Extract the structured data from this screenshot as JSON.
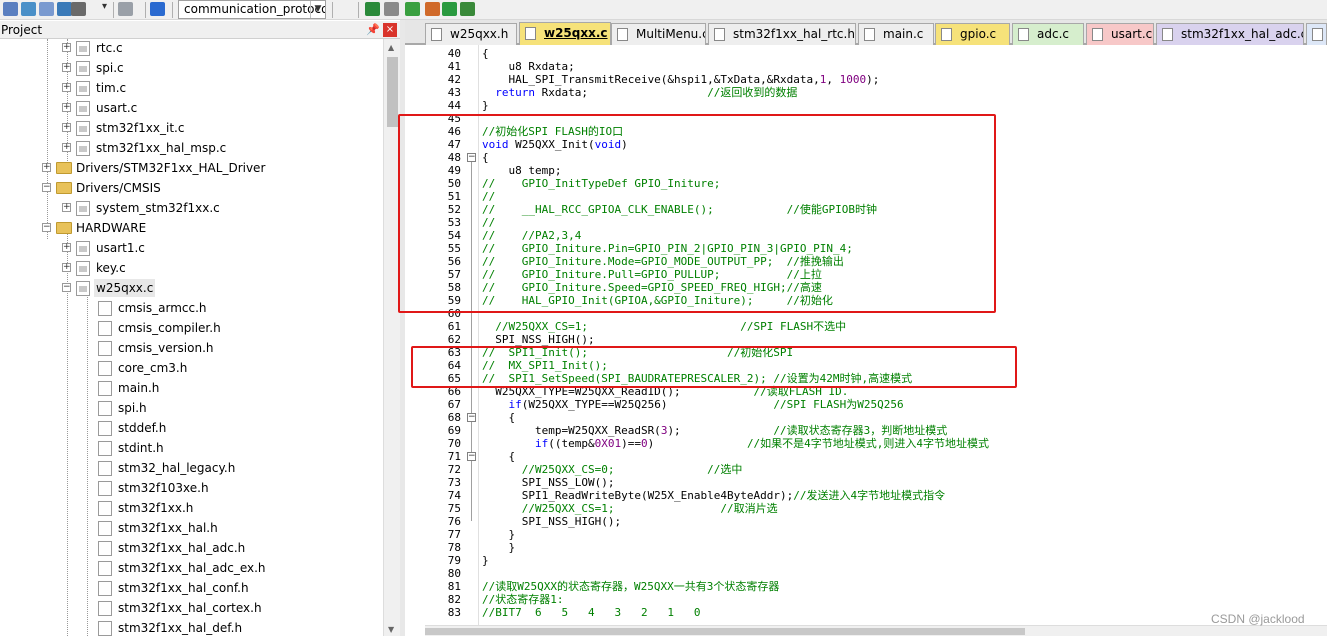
{
  "toolbar": {
    "target_combo": "communication_protoco",
    "icons": [
      "load-icon",
      "download-icon",
      "rebuild-icon",
      "translate-icon",
      "batch-build-icon",
      "options-icon",
      "debug-icon",
      "manage-components-icon",
      "pack-installer-icon",
      "select-packs-icon",
      "rte-icon",
      "run-icon",
      "template-icon"
    ]
  },
  "project_panel": {
    "title": "Project",
    "pin": "q",
    "close": "×"
  },
  "tree": [
    {
      "label": "rtc.c",
      "depth": 3,
      "type": "src",
      "expander": "+"
    },
    {
      "label": "spi.c",
      "depth": 3,
      "type": "src",
      "expander": "+"
    },
    {
      "label": "tim.c",
      "depth": 3,
      "type": "src",
      "expander": "+"
    },
    {
      "label": "usart.c",
      "depth": 3,
      "type": "src",
      "expander": "+"
    },
    {
      "label": "stm32f1xx_it.c",
      "depth": 3,
      "type": "src",
      "expander": "+"
    },
    {
      "label": "stm32f1xx_hal_msp.c",
      "depth": 3,
      "type": "src",
      "expander": "+"
    },
    {
      "label": "Drivers/STM32F1xx_HAL_Driver",
      "depth": 2,
      "type": "folder",
      "expander": "+"
    },
    {
      "label": "Drivers/CMSIS",
      "depth": 2,
      "type": "folder",
      "expander": "−"
    },
    {
      "label": "system_stm32f1xx.c",
      "depth": 3,
      "type": "src",
      "expander": "+"
    },
    {
      "label": "HARDWARE",
      "depth": 2,
      "type": "folder",
      "expander": "−"
    },
    {
      "label": "usart1.c",
      "depth": 3,
      "type": "src",
      "expander": "+"
    },
    {
      "label": "key.c",
      "depth": 3,
      "type": "src",
      "expander": "+"
    },
    {
      "label": "w25qxx.c",
      "depth": 3,
      "type": "src",
      "expander": "−",
      "selected": true
    },
    {
      "label": "cmsis_armcc.h",
      "depth": 4,
      "type": "hdr"
    },
    {
      "label": "cmsis_compiler.h",
      "depth": 4,
      "type": "hdr"
    },
    {
      "label": "cmsis_version.h",
      "depth": 4,
      "type": "hdr"
    },
    {
      "label": "core_cm3.h",
      "depth": 4,
      "type": "hdr"
    },
    {
      "label": "main.h",
      "depth": 4,
      "type": "hdr"
    },
    {
      "label": "spi.h",
      "depth": 4,
      "type": "hdr"
    },
    {
      "label": "stddef.h",
      "depth": 4,
      "type": "hdr"
    },
    {
      "label": "stdint.h",
      "depth": 4,
      "type": "hdr"
    },
    {
      "label": "stm32_hal_legacy.h",
      "depth": 4,
      "type": "hdr"
    },
    {
      "label": "stm32f103xe.h",
      "depth": 4,
      "type": "hdr"
    },
    {
      "label": "stm32f1xx.h",
      "depth": 4,
      "type": "hdr"
    },
    {
      "label": "stm32f1xx_hal.h",
      "depth": 4,
      "type": "hdr"
    },
    {
      "label": "stm32f1xx_hal_adc.h",
      "depth": 4,
      "type": "hdr"
    },
    {
      "label": "stm32f1xx_hal_adc_ex.h",
      "depth": 4,
      "type": "hdr"
    },
    {
      "label": "stm32f1xx_hal_conf.h",
      "depth": 4,
      "type": "hdr"
    },
    {
      "label": "stm32f1xx_hal_cortex.h",
      "depth": 4,
      "type": "hdr"
    },
    {
      "label": "stm32f1xx_hal_def.h",
      "depth": 4,
      "type": "hdr"
    }
  ],
  "tabs": [
    {
      "label": "w25qxx.h",
      "color": "#eeeeee",
      "active": false
    },
    {
      "label": "w25qxx.c",
      "color": "#f6e27a",
      "active": true
    },
    {
      "label": "MultiMenu.c",
      "color": "#eeeeee",
      "active": false
    },
    {
      "label": "stm32f1xx_hal_rtc.h",
      "color": "#eeeeee",
      "active": false
    },
    {
      "label": "main.c",
      "color": "#eeeeee",
      "active": false
    },
    {
      "label": "gpio.c",
      "color": "#f6e27a",
      "active": false
    },
    {
      "label": "adc.c",
      "color": "#d6eecd",
      "active": false
    },
    {
      "label": "usart.c",
      "color": "#f7c8c8",
      "active": false
    },
    {
      "label": "stm32f1xx_hal_adc.c",
      "color": "#d9d2ee",
      "active": false
    },
    {
      "label": "",
      "color": "#dde7f7",
      "active": false
    }
  ],
  "code": [
    {
      "n": "40",
      "fold": "",
      "t": [
        [
          "",
          "{"
        ]
      ]
    },
    {
      "n": "41",
      "fold": "",
      "t": [
        [
          "",
          "    u8 Rxdata;"
        ]
      ]
    },
    {
      "n": "42",
      "fold": "",
      "t": [
        [
          "",
          "    HAL_SPI_TransmitReceive(&hspi1,&TxData,&Rxdata,"
        ],
        [
          "num",
          "1"
        ],
        [
          "",
          ", "
        ],
        [
          "num",
          "1000"
        ],
        [
          "",
          ");"
        ]
      ]
    },
    {
      "n": "43",
      "fold": "",
      "t": [
        [
          "",
          "  "
        ],
        [
          "kw",
          "return"
        ],
        [
          "",
          " Rxdata;                  "
        ],
        [
          "cm",
          "//返回收到的数据"
        ]
      ]
    },
    {
      "n": "44",
      "fold": "",
      "t": [
        [
          "",
          "}"
        ]
      ]
    },
    {
      "n": "45",
      "fold": "",
      "t": [
        [
          "",
          ""
        ]
      ]
    },
    {
      "n": "46",
      "fold": "",
      "t": [
        [
          "cm",
          "//初始化SPI FLASH的IO口"
        ]
      ]
    },
    {
      "n": "47",
      "fold": "",
      "t": [
        [
          "kw",
          "void"
        ],
        [
          "",
          " W25QXX_Init("
        ],
        [
          "kw",
          "void"
        ],
        [
          "",
          ")"
        ]
      ]
    },
    {
      "n": "48",
      "fold": "−",
      "t": [
        [
          "",
          "{"
        ]
      ]
    },
    {
      "n": "49",
      "fold": "",
      "t": [
        [
          "",
          "    u8 temp;"
        ]
      ]
    },
    {
      "n": "50",
      "fold": "",
      "t": [
        [
          "cm",
          "//    GPIO_InitTypeDef GPIO_Initure;"
        ]
      ]
    },
    {
      "n": "51",
      "fold": "",
      "t": [
        [
          "cm",
          "//"
        ]
      ]
    },
    {
      "n": "52",
      "fold": "",
      "t": [
        [
          "cm",
          "//    __HAL_RCC_GPIOA_CLK_ENABLE();           //使能GPIOB时钟"
        ]
      ]
    },
    {
      "n": "53",
      "fold": "",
      "t": [
        [
          "cm",
          "//"
        ]
      ]
    },
    {
      "n": "54",
      "fold": "",
      "t": [
        [
          "cm",
          "//    //PA2,3,4"
        ]
      ]
    },
    {
      "n": "55",
      "fold": "",
      "t": [
        [
          "cm",
          "//    GPIO_Initure.Pin=GPIO_PIN_2|GPIO_PIN_3|GPIO_PIN_4;"
        ]
      ]
    },
    {
      "n": "56",
      "fold": "",
      "t": [
        [
          "cm",
          "//    GPIO_Initure.Mode=GPIO_MODE_OUTPUT_PP;  //推挽输出"
        ]
      ]
    },
    {
      "n": "57",
      "fold": "",
      "t": [
        [
          "cm",
          "//    GPIO_Initure.Pull=GPIO_PULLUP;          //上拉"
        ]
      ]
    },
    {
      "n": "58",
      "fold": "",
      "t": [
        [
          "cm",
          "//    GPIO_Initure.Speed=GPIO_SPEED_FREQ_HIGH;//高速"
        ]
      ]
    },
    {
      "n": "59",
      "fold": "",
      "t": [
        [
          "cm",
          "//    HAL_GPIO_Init(GPIOA,&GPIO_Initure);     //初始化"
        ]
      ]
    },
    {
      "n": "60",
      "fold": "",
      "t": [
        [
          "",
          ""
        ]
      ]
    },
    {
      "n": "61",
      "fold": "",
      "t": [
        [
          "",
          "  "
        ],
        [
          "cm",
          "//W25QXX_CS=1;                       //SPI FLASH不选中"
        ]
      ]
    },
    {
      "n": "62",
      "fold": "",
      "t": [
        [
          "",
          "  SPI_NSS_HIGH();"
        ]
      ]
    },
    {
      "n": "63",
      "fold": "",
      "t": [
        [
          "cm",
          "//  SPI1_Init();                     //初始化SPI"
        ]
      ]
    },
    {
      "n": "64",
      "fold": "",
      "t": [
        [
          "cm",
          "//  MX_SPI1_Init();"
        ]
      ]
    },
    {
      "n": "65",
      "fold": "",
      "t": [
        [
          "cm",
          "//  SPI1_SetSpeed(SPI_BAUDRATEPRESCALER_2); //设置为42M时钟,高速模式"
        ]
      ]
    },
    {
      "n": "66",
      "fold": "",
      "t": [
        [
          "",
          "  W25QXX_TYPE=W25QXX_ReadID();           "
        ],
        [
          "cm",
          "//读取FLASH ID."
        ]
      ]
    },
    {
      "n": "67",
      "fold": "",
      "t": [
        [
          "",
          "    "
        ],
        [
          "kw",
          "if"
        ],
        [
          "",
          "(W25QXX_TYPE==W25Q256)                "
        ],
        [
          "cm",
          "//SPI FLASH为W25Q256"
        ]
      ]
    },
    {
      "n": "68",
      "fold": "−",
      "t": [
        [
          "",
          "    {"
        ]
      ]
    },
    {
      "n": "69",
      "fold": "",
      "t": [
        [
          "",
          "        temp=W25QXX_ReadSR("
        ],
        [
          "num",
          "3"
        ],
        [
          "",
          ");              "
        ],
        [
          "cm",
          "//读取状态寄存器3，判断地址模式"
        ]
      ]
    },
    {
      "n": "70",
      "fold": "",
      "t": [
        [
          "",
          "        "
        ],
        [
          "kw",
          "if"
        ],
        [
          "",
          "((temp&"
        ],
        [
          "num",
          "0X01"
        ],
        [
          "",
          ")=="
        ],
        [
          "num",
          "0"
        ],
        [
          "",
          ")              "
        ],
        [
          "cm",
          "//如果不是4字节地址模式,则进入4字节地址模式"
        ]
      ]
    },
    {
      "n": "71",
      "fold": "−",
      "t": [
        [
          "",
          "    {"
        ]
      ]
    },
    {
      "n": "72",
      "fold": "",
      "t": [
        [
          "",
          "      "
        ],
        [
          "cm",
          "//W25QXX_CS=0;              //选中"
        ]
      ]
    },
    {
      "n": "73",
      "fold": "",
      "t": [
        [
          "",
          "      SPI_NSS_LOW();"
        ]
      ]
    },
    {
      "n": "74",
      "fold": "",
      "t": [
        [
          "",
          "      SPI1_ReadWriteByte(W25X_Enable4ByteAddr);"
        ],
        [
          "cm",
          "//发送进入4字节地址模式指令"
        ]
      ]
    },
    {
      "n": "75",
      "fold": "",
      "t": [
        [
          "",
          "      "
        ],
        [
          "cm",
          "//W25QXX_CS=1;                //取消片选"
        ]
      ]
    },
    {
      "n": "76",
      "fold": "",
      "t": [
        [
          "",
          "      SPI_NSS_HIGH();"
        ]
      ]
    },
    {
      "n": "77",
      "fold": "",
      "t": [
        [
          "",
          "    }"
        ]
      ]
    },
    {
      "n": "78",
      "fold": "",
      "t": [
        [
          "",
          "    }"
        ]
      ]
    },
    {
      "n": "79",
      "fold": "",
      "t": [
        [
          "",
          "}"
        ]
      ]
    },
    {
      "n": "80",
      "fold": "",
      "t": [
        [
          "",
          ""
        ]
      ]
    },
    {
      "n": "81",
      "fold": "",
      "t": [
        [
          "cm",
          "//读取W25QXX的状态寄存器，W25QXX一共有3个状态寄存器"
        ]
      ]
    },
    {
      "n": "82",
      "fold": "",
      "t": [
        [
          "cm",
          "//状态寄存器1:"
        ]
      ]
    },
    {
      "n": "83",
      "fold": "",
      "t": [
        [
          "cm",
          "//BIT7  6   5   4   3   2   1   0"
        ]
      ]
    }
  ],
  "watermark": "CSDN @jacklood"
}
